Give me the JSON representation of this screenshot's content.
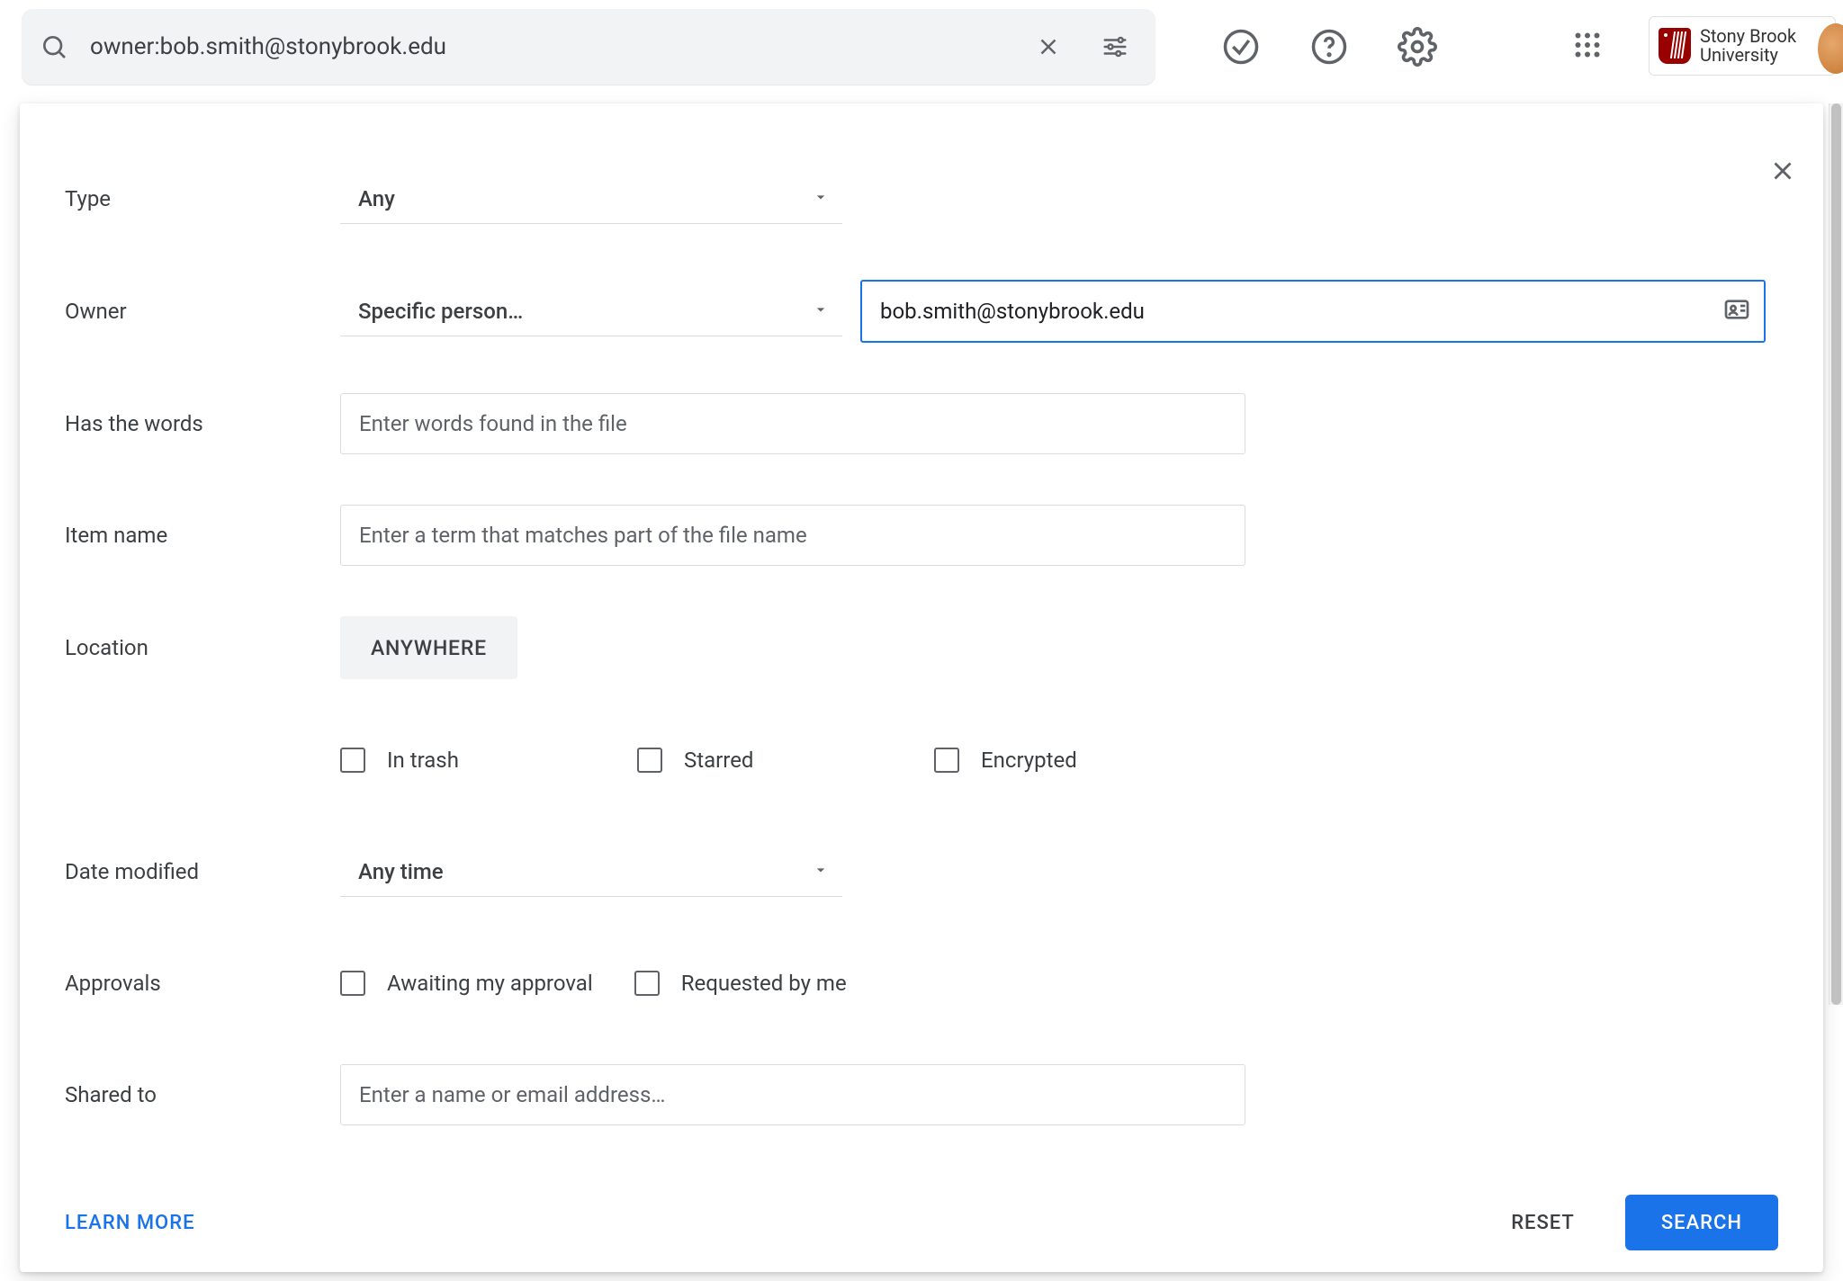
{
  "search": {
    "value": "owner:bob.smith@stonybrook.edu"
  },
  "brand": {
    "line1": "Stony Brook",
    "line2": "University"
  },
  "filters": {
    "type": {
      "label": "Type",
      "value": "Any"
    },
    "owner": {
      "label": "Owner",
      "dropdown_value": "Specific person…",
      "input_value": "bob.smith@stonybrook.edu"
    },
    "has_words": {
      "label": "Has the words",
      "placeholder": "Enter words found in the file"
    },
    "item_name": {
      "label": "Item name",
      "placeholder": "Enter a term that matches part of the file name"
    },
    "location": {
      "label": "Location",
      "chip": "ANYWHERE"
    },
    "checks": {
      "in_trash": "In trash",
      "starred": "Starred",
      "encrypted": "Encrypted"
    },
    "date_modified": {
      "label": "Date modified",
      "value": "Any time"
    },
    "approvals": {
      "label": "Approvals",
      "awaiting": "Awaiting my approval",
      "requested": "Requested by me"
    },
    "shared_to": {
      "label": "Shared to",
      "placeholder": "Enter a name or email address…"
    }
  },
  "footer": {
    "learn_more": "LEARN MORE",
    "reset": "RESET",
    "search": "SEARCH"
  }
}
